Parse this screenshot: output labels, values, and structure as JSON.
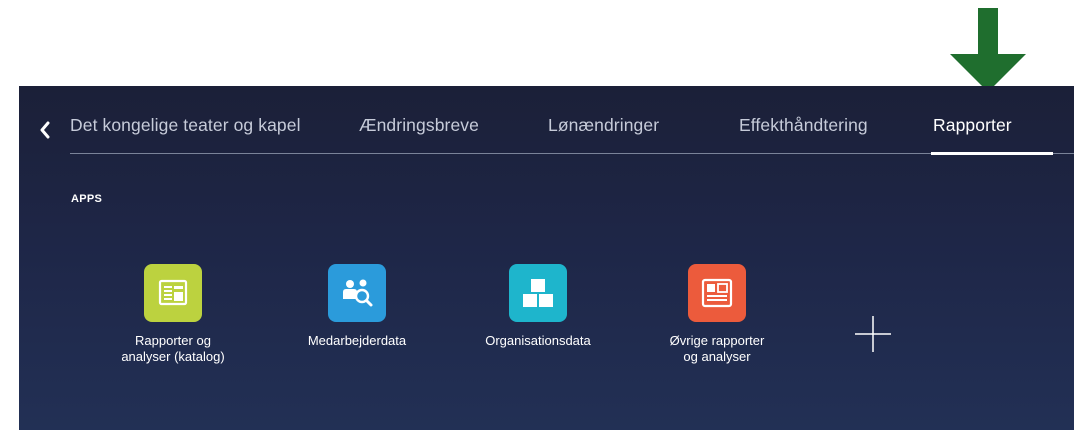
{
  "tabs": [
    {
      "label": "Det kongelige teater og kapel"
    },
    {
      "label": "Ændringsbreve"
    },
    {
      "label": "Lønændringer"
    },
    {
      "label": "Effekthåndtering"
    },
    {
      "label": "Rapporter",
      "active": true
    }
  ],
  "section": {
    "label": "APPS"
  },
  "apps": [
    {
      "label": "Rapporter og\nanalyser (katalog)",
      "icon": "report-catalog-icon",
      "color": "#bcd23f"
    },
    {
      "label": "Medarbejderdata",
      "icon": "people-search-icon",
      "color": "#2b9bdb"
    },
    {
      "label": "Organisationsdata",
      "icon": "cubes-icon",
      "color": "#1eb5cc"
    },
    {
      "label": "Øvrige rapporter\nog analyser",
      "icon": "other-reports-icon",
      "color": "#ec5b3c"
    }
  ],
  "colors": {
    "panel_background": "#1e2647",
    "annotation_arrow": "#1f6e2e"
  }
}
